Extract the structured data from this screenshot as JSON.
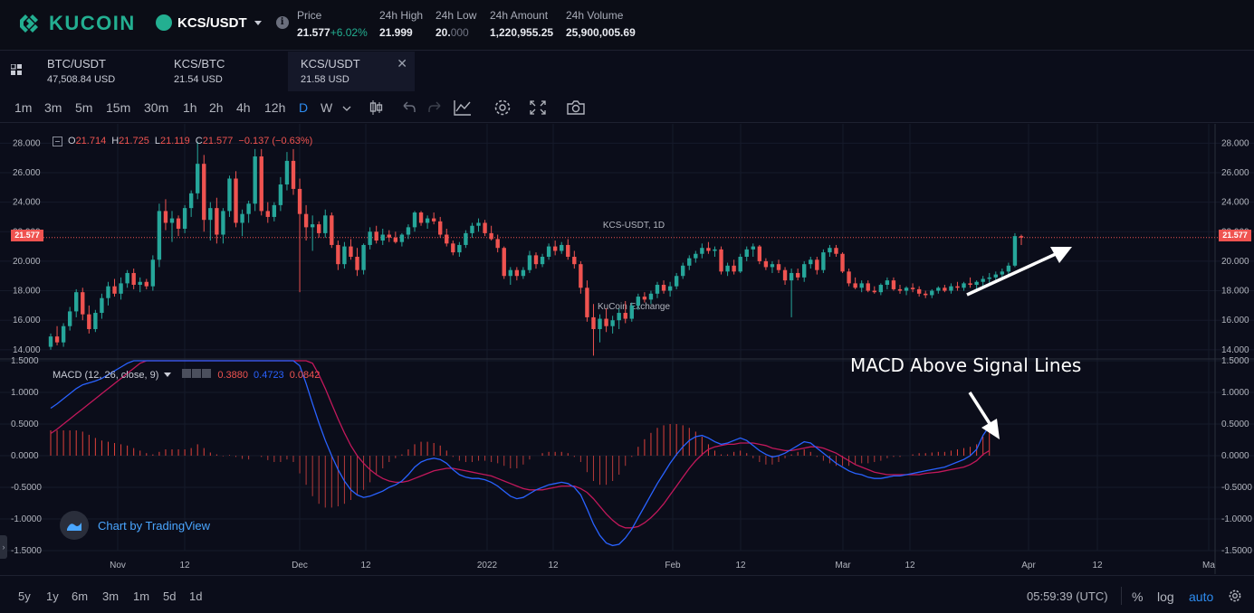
{
  "header": {
    "logo_text": "KUCOIN",
    "pair": "KCS/USDT",
    "stats": [
      {
        "label": "Price",
        "value": "21.577",
        "change": "+6.02%"
      },
      {
        "label": "24h High",
        "value": "21.999"
      },
      {
        "label": "24h Low",
        "value": "20.",
        "value_dim": "000"
      },
      {
        "label": "24h Amount",
        "value": "1,220,955.25"
      },
      {
        "label": "24h Volume",
        "value": "25,900,005.69"
      }
    ],
    "accent_color": "#23af91"
  },
  "tabs": [
    {
      "pair": "BTC/USDT",
      "price": "47,508.84 USD"
    },
    {
      "pair": "KCS/BTC",
      "price": "21.54 USD"
    },
    {
      "pair": "KCS/USDT",
      "price": "21.58 USD",
      "active": true,
      "close": "✕"
    }
  ],
  "toolbar": {
    "timeframes": [
      "1m",
      "3m",
      "5m",
      "15m",
      "30m",
      "1h",
      "2h",
      "4h",
      "12h",
      "D",
      "W"
    ],
    "active_timeframe": "D",
    "icons": [
      "chevron-down-icon",
      "candles-icon",
      "undo-icon",
      "redo-icon",
      "indicators-icon",
      "settings-icon",
      "fullscreen-icon",
      "camera-icon"
    ]
  },
  "chart": {
    "ohlc": {
      "o_label": "O",
      "o": "21.714",
      "h_label": "H",
      "h": "21.725",
      "l_label": "L",
      "l": "21.119",
      "c_label": "C",
      "c": "21.577",
      "change": "−0.137 (−0.63%)"
    },
    "last_price_tag": "21.577",
    "price_axis_labels": [
      "28.000",
      "26.000",
      "24.000",
      "22.000",
      "20.000",
      "18.000",
      "16.000",
      "14.000"
    ],
    "macd_axis_labels": [
      "1.5000",
      "1.0000",
      "0.5000",
      "0.0000",
      "-0.5000",
      "-1.0000",
      "-1.5000"
    ],
    "time_axis_labels": [
      "Nov",
      "12",
      "Dec",
      "12",
      "2022",
      "12",
      "Feb",
      "12",
      "Mar",
      "12",
      "Apr",
      "12",
      "Ma"
    ],
    "watermark_title": "KCS-USDT, 1D",
    "watermark_sub": "KuCoin Exchange",
    "macd_legend": {
      "name": "MACD (12, 26, close, 9)",
      "hist": "0.3880",
      "macd": "0.4723",
      "signal": "0.0842"
    },
    "annotation": "MACD Above Signal Lines",
    "tradingview_label": "Chart by TradingView",
    "up_color": "#26a69a",
    "down_color": "#ef5350",
    "macd_color": "#2962ff",
    "signal_color": "#c2185b"
  },
  "chart_data": {
    "type": "candlestick",
    "series_name": "KCS/USDT",
    "price_range": [
      13.5,
      29.0
    ],
    "macd_range": [
      -1.5,
      1.5
    ],
    "candles": [
      [
        14.2,
        15.1,
        14.0,
        14.9
      ],
      [
        14.9,
        15.6,
        14.3,
        14.5
      ],
      [
        14.5,
        15.8,
        14.2,
        15.6
      ],
      [
        15.6,
        16.9,
        15.3,
        16.6
      ],
      [
        16.6,
        18.1,
        16.2,
        17.9
      ],
      [
        17.9,
        18.2,
        16.0,
        16.4
      ],
      [
        16.4,
        17.0,
        15.1,
        15.4
      ],
      [
        15.4,
        16.7,
        15.2,
        16.5
      ],
      [
        16.5,
        17.8,
        16.1,
        17.5
      ],
      [
        17.5,
        18.6,
        17.0,
        18.3
      ],
      [
        18.3,
        18.8,
        17.6,
        17.8
      ],
      [
        17.8,
        18.9,
        17.4,
        18.5
      ],
      [
        18.5,
        19.4,
        18.2,
        19.2
      ],
      [
        19.2,
        19.5,
        18.1,
        18.4
      ],
      [
        18.4,
        18.9,
        17.9,
        18.6
      ],
      [
        18.6,
        18.8,
        18.1,
        18.3
      ],
      [
        18.3,
        20.4,
        18.0,
        20.1
      ],
      [
        20.1,
        23.9,
        19.6,
        23.4
      ],
      [
        23.4,
        24.2,
        22.1,
        22.6
      ],
      [
        22.6,
        23.4,
        21.3,
        22.9
      ],
      [
        22.9,
        23.1,
        21.7,
        22.2
      ],
      [
        22.2,
        23.8,
        21.9,
        23.6
      ],
      [
        23.6,
        24.8,
        23.0,
        24.6
      ],
      [
        24.6,
        28.1,
        24.2,
        26.6
      ],
      [
        26.6,
        27.2,
        22.0,
        22.8
      ],
      [
        22.8,
        24.0,
        21.4,
        23.6
      ],
      [
        23.6,
        24.3,
        21.2,
        21.8
      ],
      [
        21.8,
        23.6,
        21.2,
        23.4
      ],
      [
        23.4,
        25.8,
        23.0,
        25.6
      ],
      [
        25.6,
        26.1,
        22.3,
        22.6
      ],
      [
        22.6,
        23.5,
        21.7,
        23.2
      ],
      [
        23.2,
        24.1,
        22.6,
        23.9
      ],
      [
        23.9,
        27.6,
        23.4,
        27.1
      ],
      [
        27.1,
        27.6,
        23.1,
        23.4
      ],
      [
        23.4,
        24.0,
        22.6,
        23.0
      ],
      [
        23.0,
        24.0,
        22.7,
        23.8
      ],
      [
        23.8,
        25.7,
        23.4,
        25.2
      ],
      [
        25.2,
        27.4,
        24.8,
        26.8
      ],
      [
        26.8,
        27.6,
        24.5,
        24.9
      ],
      [
        24.9,
        25.6,
        17.9,
        23.2
      ],
      [
        23.2,
        23.8,
        21.4,
        22.3
      ],
      [
        22.3,
        23.1,
        20.7,
        22.5
      ],
      [
        22.5,
        22.7,
        21.6,
        21.9
      ],
      [
        21.9,
        23.5,
        21.6,
        23.1
      ],
      [
        23.1,
        23.3,
        20.9,
        21.1
      ],
      [
        21.1,
        21.4,
        19.4,
        19.8
      ],
      [
        19.8,
        21.3,
        19.5,
        21.0
      ],
      [
        21.0,
        21.5,
        20.1,
        20.3
      ],
      [
        20.3,
        20.9,
        19.0,
        19.4
      ],
      [
        19.4,
        21.2,
        19.1,
        21.1
      ],
      [
        21.1,
        22.3,
        20.8,
        22.0
      ],
      [
        22.0,
        22.4,
        21.2,
        21.4
      ],
      [
        21.4,
        22.2,
        21.1,
        21.8
      ],
      [
        21.8,
        22.1,
        21.3,
        21.6
      ],
      [
        21.6,
        22.0,
        21.2,
        21.3
      ],
      [
        21.3,
        21.9,
        21.0,
        21.8
      ],
      [
        21.8,
        22.5,
        21.5,
        22.3
      ],
      [
        22.3,
        23.4,
        22.0,
        23.3
      ],
      [
        23.3,
        23.4,
        22.4,
        22.6
      ],
      [
        22.6,
        23.1,
        22.2,
        22.9
      ],
      [
        22.9,
        23.3,
        22.5,
        22.7
      ],
      [
        22.7,
        23.0,
        21.6,
        21.8
      ],
      [
        21.8,
        22.2,
        21.0,
        21.2
      ],
      [
        21.2,
        21.4,
        20.4,
        20.6
      ],
      [
        20.6,
        21.3,
        20.3,
        21.1
      ],
      [
        21.1,
        22.1,
        20.9,
        21.9
      ],
      [
        21.9,
        22.6,
        21.6,
        22.4
      ],
      [
        22.4,
        22.9,
        22.0,
        22.6
      ],
      [
        22.6,
        22.8,
        21.7,
        21.9
      ],
      [
        21.9,
        22.4,
        21.4,
        21.5
      ],
      [
        21.5,
        21.8,
        20.6,
        20.9
      ],
      [
        20.9,
        21.0,
        18.8,
        19.0
      ],
      [
        19.0,
        19.6,
        18.4,
        19.4
      ],
      [
        19.4,
        19.6,
        18.7,
        19.0
      ],
      [
        19.0,
        19.6,
        18.8,
        19.4
      ],
      [
        19.4,
        20.7,
        19.2,
        20.4
      ],
      [
        20.4,
        20.6,
        19.5,
        19.8
      ],
      [
        19.8,
        20.5,
        19.6,
        20.3
      ],
      [
        20.3,
        21.2,
        20.1,
        21.0
      ],
      [
        21.0,
        21.4,
        20.4,
        20.7
      ],
      [
        20.7,
        21.3,
        20.5,
        21.1
      ],
      [
        21.1,
        21.5,
        20.1,
        20.3
      ],
      [
        20.3,
        20.7,
        19.5,
        19.8
      ],
      [
        19.8,
        20.0,
        17.8,
        18.2
      ],
      [
        18.2,
        18.7,
        15.9,
        16.2
      ],
      [
        16.2,
        17.1,
        13.6,
        15.4
      ],
      [
        15.4,
        16.4,
        14.5,
        16.1
      ],
      [
        16.1,
        16.8,
        15.2,
        15.6
      ],
      [
        15.6,
        16.3,
        15.1,
        16.0
      ],
      [
        16.0,
        16.8,
        15.4,
        16.5
      ],
      [
        16.5,
        17.3,
        15.8,
        16.1
      ],
      [
        16.1,
        17.2,
        15.9,
        17.0
      ],
      [
        17.0,
        17.8,
        16.7,
        17.6
      ],
      [
        17.6,
        17.9,
        17.2,
        17.4
      ],
      [
        17.4,
        18.0,
        17.1,
        17.8
      ],
      [
        17.8,
        18.6,
        17.5,
        18.4
      ],
      [
        18.4,
        18.7,
        17.8,
        18.0
      ],
      [
        18.0,
        18.6,
        17.6,
        18.3
      ],
      [
        18.3,
        19.2,
        18.1,
        19.0
      ],
      [
        19.0,
        19.9,
        18.8,
        19.7
      ],
      [
        19.7,
        20.4,
        19.4,
        20.2
      ],
      [
        20.2,
        20.7,
        19.9,
        20.5
      ],
      [
        20.5,
        21.2,
        20.2,
        20.9
      ],
      [
        20.9,
        21.3,
        20.5,
        20.7
      ],
      [
        20.7,
        21.0,
        20.3,
        20.8
      ],
      [
        20.8,
        21.0,
        19.1,
        19.3
      ],
      [
        19.3,
        19.9,
        19.0,
        19.7
      ],
      [
        19.7,
        20.1,
        19.1,
        19.3
      ],
      [
        19.3,
        20.5,
        19.2,
        20.3
      ],
      [
        20.3,
        21.0,
        20.0,
        20.8
      ],
      [
        20.8,
        21.2,
        20.3,
        21.0
      ],
      [
        21.0,
        21.1,
        19.8,
        20.0
      ],
      [
        20.0,
        20.2,
        19.4,
        19.6
      ],
      [
        19.6,
        20.0,
        19.2,
        19.8
      ],
      [
        19.8,
        20.1,
        19.2,
        19.4
      ],
      [
        19.4,
        19.6,
        18.4,
        18.7
      ],
      [
        18.7,
        19.5,
        16.2,
        19.2
      ],
      [
        19.2,
        19.5,
        18.7,
        18.9
      ],
      [
        18.9,
        20.0,
        18.6,
        19.8
      ],
      [
        19.8,
        20.3,
        19.5,
        20.1
      ],
      [
        20.1,
        20.3,
        19.1,
        19.4
      ],
      [
        19.4,
        20.8,
        19.2,
        20.6
      ],
      [
        20.6,
        21.1,
        20.3,
        20.9
      ],
      [
        20.9,
        21.1,
        20.3,
        20.5
      ],
      [
        20.5,
        20.6,
        19.2,
        19.3
      ],
      [
        19.3,
        19.5,
        18.3,
        18.5
      ],
      [
        18.5,
        18.9,
        18.1,
        18.2
      ],
      [
        18.2,
        18.7,
        17.9,
        18.5
      ],
      [
        18.5,
        18.7,
        17.9,
        18.0
      ],
      [
        18.0,
        18.3,
        17.8,
        17.9
      ],
      [
        17.9,
        18.5,
        17.7,
        18.4
      ],
      [
        18.4,
        18.9,
        18.1,
        18.7
      ],
      [
        18.7,
        18.9,
        18.0,
        18.1
      ],
      [
        18.1,
        18.4,
        17.8,
        18.0
      ],
      [
        18.0,
        18.3,
        17.7,
        18.2
      ],
      [
        18.2,
        18.5,
        17.9,
        18.1
      ],
      [
        18.1,
        18.3,
        17.6,
        17.8
      ],
      [
        17.8,
        18.0,
        17.5,
        17.7
      ],
      [
        17.7,
        18.1,
        17.5,
        18.0
      ],
      [
        18.0,
        18.3,
        17.8,
        18.2
      ],
      [
        18.2,
        18.4,
        17.9,
        18.0
      ],
      [
        18.0,
        18.5,
        17.8,
        18.3
      ],
      [
        18.3,
        18.6,
        18.0,
        18.2
      ],
      [
        18.2,
        18.6,
        18.0,
        18.5
      ],
      [
        18.5,
        18.9,
        18.2,
        18.4
      ],
      [
        18.4,
        18.7,
        18.1,
        18.6
      ],
      [
        18.6,
        19.0,
        18.3,
        18.8
      ],
      [
        18.8,
        19.2,
        18.5,
        18.9
      ],
      [
        18.9,
        19.3,
        18.6,
        19.1
      ],
      [
        19.1,
        19.5,
        18.8,
        19.3
      ],
      [
        19.3,
        19.9,
        19.1,
        19.7
      ],
      [
        19.7,
        21.9,
        19.6,
        21.7
      ],
      [
        21.7,
        21.8,
        21.1,
        21.6
      ]
    ],
    "macd": [
      0.75,
      0.82,
      0.9,
      0.98,
      1.06,
      1.12,
      1.15,
      1.18,
      1.22,
      1.28,
      1.34,
      1.4,
      1.46,
      1.5,
      1.54,
      1.56,
      1.6,
      1.7,
      1.8,
      1.86,
      1.9,
      1.94,
      2.0,
      2.1,
      2.06,
      2.0,
      1.96,
      1.92,
      1.94,
      1.9,
      1.86,
      1.84,
      1.9,
      1.86,
      1.78,
      1.72,
      1.7,
      1.72,
      1.66,
      1.42,
      1.14,
      0.82,
      0.52,
      0.24,
      0.0,
      -0.22,
      -0.4,
      -0.54,
      -0.62,
      -0.66,
      -0.64,
      -0.6,
      -0.56,
      -0.5,
      -0.46,
      -0.4,
      -0.3,
      -0.18,
      -0.1,
      -0.06,
      -0.04,
      -0.06,
      -0.12,
      -0.22,
      -0.3,
      -0.34,
      -0.36,
      -0.36,
      -0.38,
      -0.42,
      -0.48,
      -0.56,
      -0.64,
      -0.68,
      -0.66,
      -0.6,
      -0.54,
      -0.5,
      -0.46,
      -0.44,
      -0.42,
      -0.44,
      -0.5,
      -0.62,
      -0.84,
      -1.08,
      -1.26,
      -1.38,
      -1.42,
      -1.4,
      -1.3,
      -1.16,
      -0.98,
      -0.8,
      -0.62,
      -0.44,
      -0.28,
      -0.12,
      0.02,
      0.14,
      0.24,
      0.3,
      0.32,
      0.28,
      0.22,
      0.18,
      0.2,
      0.24,
      0.28,
      0.24,
      0.16,
      0.08,
      0.02,
      -0.02,
      0.0,
      0.04,
      0.1,
      0.16,
      0.22,
      0.2,
      0.12,
      0.04,
      -0.04,
      -0.12,
      -0.18,
      -0.24,
      -0.28,
      -0.3,
      -0.34,
      -0.36,
      -0.36,
      -0.34,
      -0.32,
      -0.32,
      -0.3,
      -0.28,
      -0.26,
      -0.24,
      -0.22,
      -0.2,
      -0.18,
      -0.14,
      -0.1,
      -0.06,
      0.0,
      0.1,
      0.32,
      0.47
    ],
    "signal": [
      0.35,
      0.42,
      0.5,
      0.58,
      0.66,
      0.74,
      0.82,
      0.9,
      0.98,
      1.06,
      1.14,
      1.22,
      1.3,
      1.38,
      1.46,
      1.52,
      1.58,
      1.64,
      1.7,
      1.76,
      1.8,
      1.84,
      1.88,
      1.92,
      1.94,
      1.95,
      1.94,
      1.93,
      1.93,
      1.92,
      1.91,
      1.9,
      1.9,
      1.88,
      1.85,
      1.82,
      1.8,
      1.78,
      1.76,
      1.7,
      1.6,
      1.46,
      1.28,
      1.06,
      0.82,
      0.58,
      0.36,
      0.16,
      0.0,
      -0.12,
      -0.22,
      -0.3,
      -0.36,
      -0.4,
      -0.42,
      -0.42,
      -0.4,
      -0.36,
      -0.32,
      -0.28,
      -0.24,
      -0.22,
      -0.2,
      -0.2,
      -0.22,
      -0.24,
      -0.26,
      -0.28,
      -0.3,
      -0.32,
      -0.36,
      -0.4,
      -0.44,
      -0.48,
      -0.52,
      -0.54,
      -0.54,
      -0.54,
      -0.52,
      -0.5,
      -0.48,
      -0.48,
      -0.48,
      -0.52,
      -0.58,
      -0.68,
      -0.8,
      -0.92,
      -1.02,
      -1.1,
      -1.14,
      -1.14,
      -1.12,
      -1.06,
      -0.98,
      -0.88,
      -0.76,
      -0.62,
      -0.48,
      -0.34,
      -0.2,
      -0.08,
      0.02,
      0.1,
      0.14,
      0.16,
      0.18,
      0.18,
      0.2,
      0.2,
      0.2,
      0.18,
      0.16,
      0.12,
      0.1,
      0.08,
      0.08,
      0.1,
      0.12,
      0.14,
      0.14,
      0.12,
      0.08,
      0.04,
      -0.02,
      -0.08,
      -0.14,
      -0.18,
      -0.22,
      -0.26,
      -0.28,
      -0.3,
      -0.3,
      -0.3,
      -0.3,
      -0.3,
      -0.3,
      -0.28,
      -0.27,
      -0.26,
      -0.24,
      -0.22,
      -0.2,
      -0.18,
      -0.14,
      -0.08,
      0.02,
      0.08
    ]
  },
  "bottom": {
    "ranges": [
      "5y",
      "1y",
      "6m",
      "3m",
      "1m",
      "5d",
      "1d"
    ],
    "clock": "05:59:39 (UTC)",
    "pct": "%",
    "log": "log",
    "auto": "auto"
  }
}
